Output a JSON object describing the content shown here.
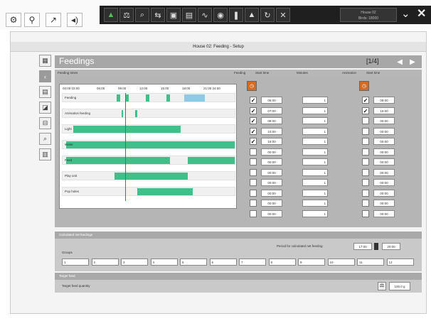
{
  "window": {
    "title": "House 02: Feeding - Setup",
    "house_label": "House 02",
    "house_sub": "Birds: 18000"
  },
  "toolbar_left": [
    {
      "icon": "search-settings-icon",
      "glyph": "⚙"
    },
    {
      "icon": "grid-settings-icon",
      "glyph": "⚲"
    },
    {
      "icon": "graph-icon",
      "glyph": "↗"
    },
    {
      "icon": "sound-icon",
      "glyph": "◂)"
    }
  ],
  "toolbar_dark": [
    {
      "icon": "feeder-icon",
      "glyph": "▲",
      "color": "#5cb85c"
    },
    {
      "icon": "scale-icon",
      "glyph": "⚖"
    },
    {
      "icon": "magnify-icon",
      "glyph": "⌕"
    },
    {
      "icon": "settings-toggle-icon",
      "glyph": "⇆"
    },
    {
      "icon": "monitor-icon",
      "glyph": "▣"
    },
    {
      "icon": "chart-icon",
      "glyph": "▤"
    },
    {
      "icon": "curve-icon",
      "glyph": "∿"
    },
    {
      "icon": "gauge-icon",
      "glyph": "◉"
    },
    {
      "icon": "water-icon",
      "glyph": "❚"
    },
    {
      "icon": "mountain-icon",
      "glyph": "▲"
    },
    {
      "icon": "recycle-icon",
      "glyph": "↻"
    },
    {
      "icon": "tools-icon",
      "glyph": "✕"
    }
  ],
  "sidebar": [
    {
      "icon": "grid-view-icon",
      "glyph": "▦"
    },
    {
      "icon": "back-arrow-icon",
      "glyph": "‹"
    },
    {
      "icon": "doc-icon",
      "glyph": "▤"
    },
    {
      "icon": "image-icon",
      "glyph": "◪"
    },
    {
      "icon": "lock-icon",
      "glyph": "⊟"
    },
    {
      "icon": "search-icon",
      "glyph": "⌕"
    },
    {
      "icon": "table-icon",
      "glyph": "▥"
    }
  ],
  "panel": {
    "title": "Feedings",
    "page_index": "[1/4]",
    "columns": {
      "feeding_times": "Feeding times",
      "feeding": "Feeding",
      "start_time": "Start time",
      "minutes": "Minutes",
      "animation": "Animation",
      "start_time2": "Start time"
    }
  },
  "timeline": {
    "ticks": [
      "02:00 03:00",
      "06:00",
      "09:00",
      "12:00",
      "15:00",
      "18:00",
      "21:00 24:00"
    ],
    "rows": [
      {
        "label": "Feeding",
        "segments": [
          [
            0.31,
            0.33
          ],
          [
            0.36,
            0.38
          ],
          [
            0.48,
            0.5
          ],
          [
            0.6,
            0.62
          ],
          [
            0.7,
            0.82
          ]
        ],
        "color": "#3fbf8a"
      },
      {
        "label": "Animation feeding",
        "segments": [
          [
            0.34,
            0.35
          ],
          [
            0.42,
            0.43
          ]
        ],
        "color": "#3fbf8a"
      },
      {
        "label": "Light",
        "segments": [
          [
            0.06,
            0.68
          ]
        ],
        "color": "#3fbf8a"
      },
      {
        "label": "Water",
        "segments": [
          [
            0.02,
            0.99
          ]
        ],
        "color": "#3fbf8a"
      },
      {
        "label": "Feed",
        "segments": [
          [
            0.02,
            0.62
          ],
          [
            0.72,
            0.99
          ]
        ],
        "color": "#3fbf8a"
      },
      {
        "label": "Play unit",
        "segments": [
          [
            0.3,
            0.72
          ]
        ],
        "color": "#3fbf8a"
      },
      {
        "label": "Pop holes",
        "segments": [
          [
            0.43,
            0.75
          ]
        ],
        "color": "#3fbf8a"
      }
    ]
  },
  "feedings_list": [
    {
      "checked": true,
      "time": "06:00",
      "min": "1"
    },
    {
      "checked": true,
      "time": "07:00",
      "min": "1"
    },
    {
      "checked": true,
      "time": "08:00",
      "min": "1"
    },
    {
      "checked": true,
      "time": "10:00",
      "min": "1"
    },
    {
      "checked": true,
      "time": "16:00",
      "min": "1"
    },
    {
      "checked": false,
      "time": "00:00",
      "min": "1"
    },
    {
      "checked": false,
      "time": "00:00",
      "min": "1"
    },
    {
      "checked": false,
      "time": "00:00",
      "min": "1"
    },
    {
      "checked": false,
      "time": "00:00",
      "min": "1"
    },
    {
      "checked": false,
      "time": "00:00",
      "min": "1"
    },
    {
      "checked": false,
      "time": "00:00",
      "min": "1"
    },
    {
      "checked": false,
      "time": "00:00",
      "min": "1"
    }
  ],
  "animation_list": [
    {
      "checked": true,
      "time": "09:00"
    },
    {
      "checked": true,
      "time": "15:00"
    },
    {
      "checked": false,
      "time": "00:00"
    },
    {
      "checked": false,
      "time": "00:00"
    },
    {
      "checked": false,
      "time": "00:00"
    },
    {
      "checked": false,
      "time": "00:00"
    },
    {
      "checked": false,
      "time": "00:00"
    },
    {
      "checked": false,
      "time": "00:00"
    },
    {
      "checked": false,
      "time": "00:00"
    },
    {
      "checked": false,
      "time": "00:00"
    },
    {
      "checked": false,
      "time": "00:00"
    },
    {
      "checked": false,
      "time": "00:00"
    }
  ],
  "calculated": {
    "header": "Calculated net feedings",
    "period_label": "Period for calculated net feeding",
    "from": "17:00",
    "to": "20:00",
    "groups_label": "Groups",
    "groups": [
      "1",
      "2",
      "3",
      "4",
      "5",
      "6",
      "7",
      "8",
      "9",
      "10",
      "11",
      "12"
    ]
  },
  "target_feed": {
    "header": "Target feed",
    "label": "Target feed quantity",
    "value": "100.0 g"
  }
}
